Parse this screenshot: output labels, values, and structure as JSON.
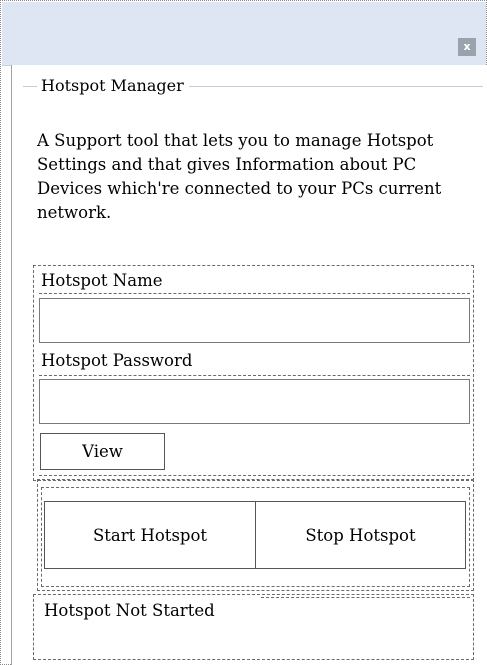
{
  "window": {
    "close_glyph": "x"
  },
  "group": {
    "title": "Hotspot Manager",
    "description": "A Support tool that lets you to manage Hotspot Settings and that gives Information about PC Devices which're connected to your PCs current network."
  },
  "hotspot_name": {
    "label": "Hotspot Name",
    "value": ""
  },
  "hotspot_password": {
    "label": "Hotspot Password",
    "value": ""
  },
  "view_button": {
    "label": "View"
  },
  "actions": {
    "start_label": "Start Hotspot",
    "stop_label": "Stop Hotspot"
  },
  "status": {
    "text": "Hotspot Not Started"
  },
  "colors": {
    "titlebar": "#dde6f2",
    "close_button": "#9aa3ad",
    "dashed_border": "#6a6a6a"
  }
}
